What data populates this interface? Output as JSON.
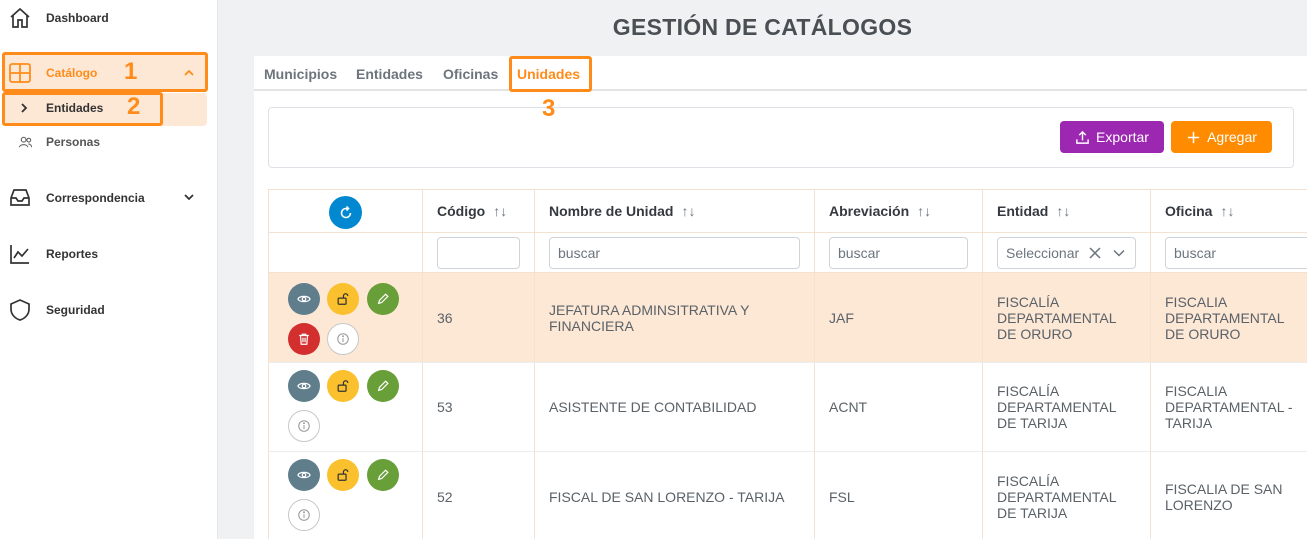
{
  "sidebar": {
    "items": [
      {
        "label": "Dashboard",
        "icon": "home-icon"
      },
      {
        "label": "Catálogo",
        "icon": "grid-icon"
      },
      {
        "label": "Entidades",
        "icon": "chevron-right-icon"
      },
      {
        "label": "Personas",
        "icon": "users-icon"
      },
      {
        "label": "Correspondencia",
        "icon": "inbox-icon"
      },
      {
        "label": "Reportes",
        "icon": "chart-line-icon"
      },
      {
        "label": "Seguridad",
        "icon": "shield-icon"
      }
    ]
  },
  "annotations": [
    "1",
    "2",
    "3"
  ],
  "page_title": "GESTIÓN DE CATÁLOGOS",
  "tabs": [
    "Municipios",
    "Entidades",
    "Oficinas",
    "Unidades"
  ],
  "active_tab": "Unidades",
  "toolbar": {
    "export_label": "Exportar",
    "add_label": "Agregar"
  },
  "colors": {
    "accent": "#ff8c1a",
    "export": "#9c27b0",
    "add": "#ff8c00",
    "selected_row": "#fde7d5",
    "refresh": "#0288d1"
  },
  "table": {
    "columns": [
      "Código",
      "Nombre de Unidad",
      "Abreviación",
      "Entidad",
      "Oficina"
    ],
    "filters": {
      "codigo": "",
      "nombre_placeholder": "buscar",
      "abreviacion_placeholder": "buscar",
      "entidad_placeholder": "Seleccionar",
      "oficina_placeholder": "buscar"
    },
    "rows": [
      {
        "codigo": "36",
        "nombre": [
          "JEFATURA ADMINSITRATIVA Y",
          "FINANCIERA"
        ],
        "abreviacion": "JAF",
        "entidad": [
          "FISCALÍA",
          "DEPARTAMENTAL",
          "DE ORURO"
        ],
        "oficina": [
          "FISCALIA",
          "DEPARTAMENTAL",
          "DE ORURO"
        ]
      },
      {
        "codigo": "53",
        "nombre": [
          "ASISTENTE DE CONTABILIDAD"
        ],
        "abreviacion": "ACNT",
        "entidad": [
          "FISCALÍA",
          "DEPARTAMENTAL",
          "DE TARIJA"
        ],
        "oficina": [
          "FISCALIA",
          "DEPARTAMENTAL -",
          "TARIJA"
        ]
      },
      {
        "codigo": "52",
        "nombre": [
          "FISCAL DE SAN LORENZO - TARIJA"
        ],
        "abreviacion": "FSL",
        "entidad": [
          "FISCALÍA",
          "DEPARTAMENTAL",
          "DE TARIJA"
        ],
        "oficina": [
          "FISCALIA DE SAN",
          "LORENZO"
        ]
      }
    ]
  }
}
